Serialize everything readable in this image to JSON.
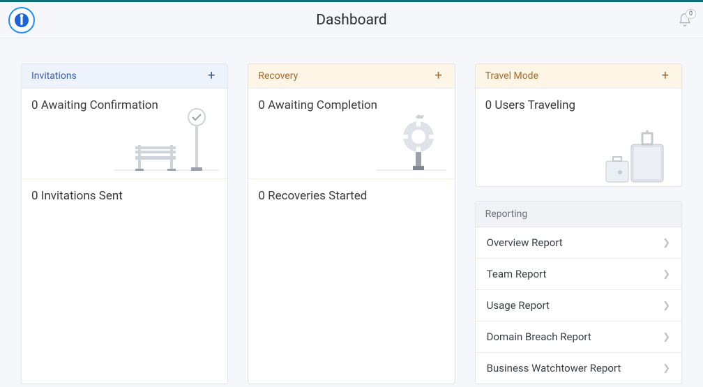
{
  "header": {
    "title": "Dashboard",
    "notifications_count": "0"
  },
  "invitations": {
    "title": "Invitations",
    "awaiting": "0 Awaiting Confirmation",
    "sent": "0 Invitations Sent"
  },
  "recovery": {
    "title": "Recovery",
    "awaiting": "0 Awaiting Completion",
    "started": "0 Recoveries Started"
  },
  "travel": {
    "title": "Travel Mode",
    "users": "0 Users Traveling"
  },
  "reporting": {
    "title": "Reporting",
    "items": [
      {
        "label": "Overview Report"
      },
      {
        "label": "Team Report"
      },
      {
        "label": "Usage Report"
      },
      {
        "label": "Domain Breach Report"
      },
      {
        "label": "Business Watchtower Report"
      }
    ]
  }
}
